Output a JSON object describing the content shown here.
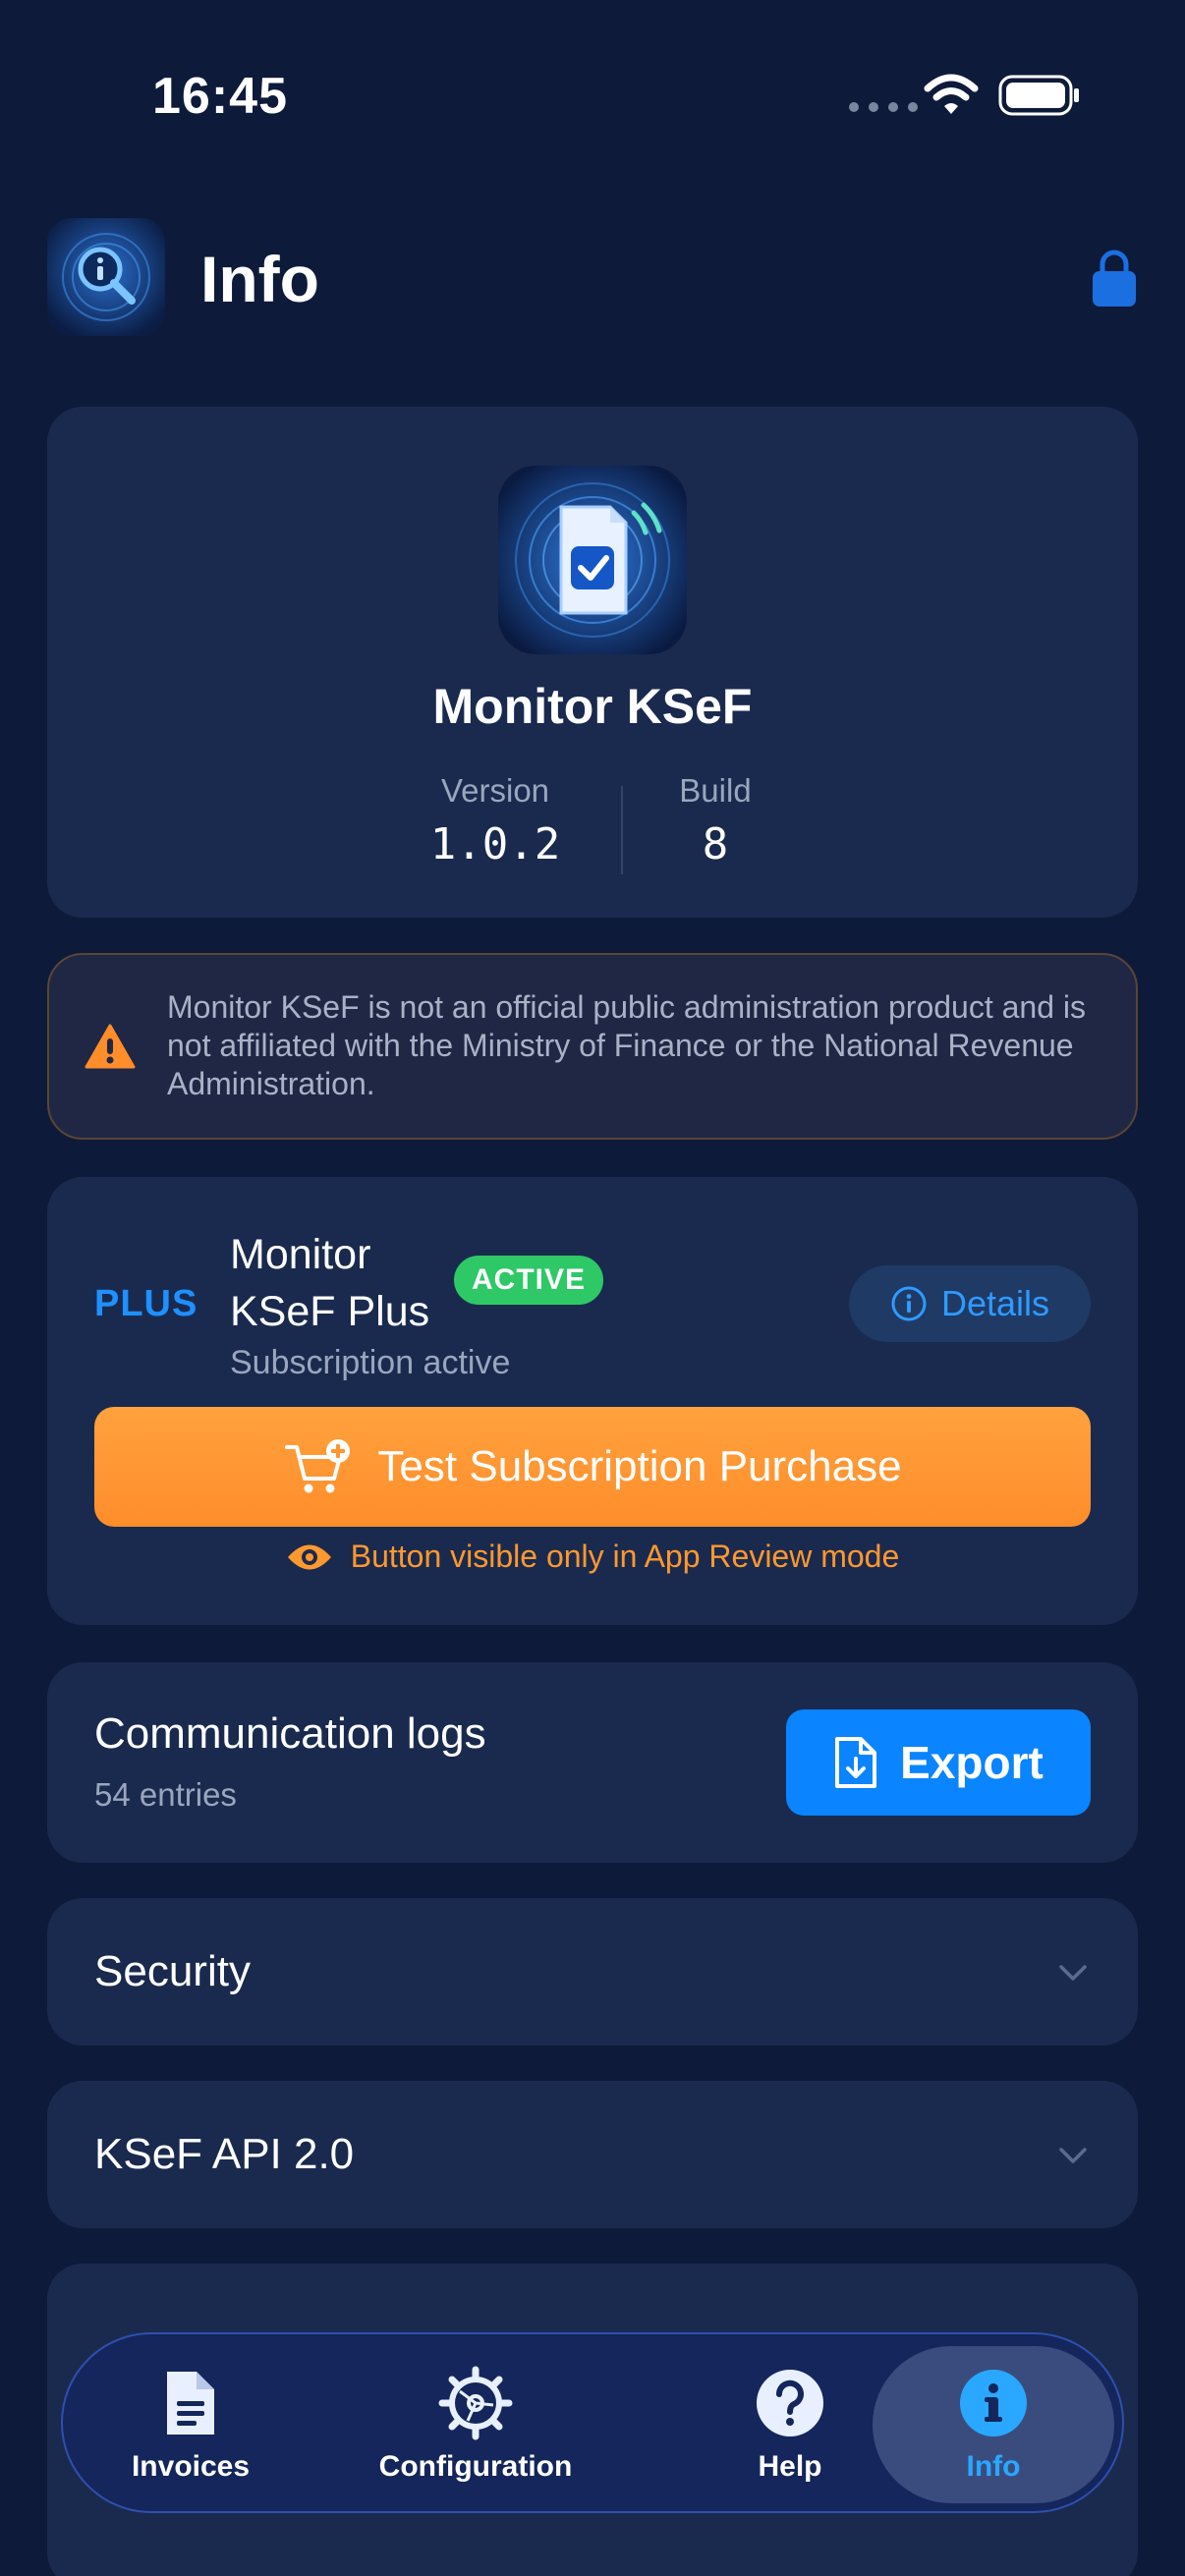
{
  "status_bar": {
    "time": "16:45"
  },
  "header": {
    "title": "Info"
  },
  "app_info": {
    "name": "Monitor KSeF",
    "version_label": "Version",
    "version": "1.0.2",
    "build_label": "Build",
    "build": "8"
  },
  "disclaimer": {
    "text": "Monitor KSeF is not an official public administration product and is not affiliated with the Ministry of Finance or the National Revenue Administration."
  },
  "subscription": {
    "plus_label": "PLUS",
    "title": "Monitor KSeF Plus",
    "badge": "ACTIVE",
    "status": "Subscription active",
    "details_label": "Details",
    "purchase_label": "Test Subscription Purchase",
    "review_note": "Button visible only in App Review mode"
  },
  "logs": {
    "title": "Communication logs",
    "count": "54 entries",
    "export_label": "Export"
  },
  "sections": {
    "security": "Security",
    "api": "KSeF API 2.0"
  },
  "tabs": {
    "invoices": "Invoices",
    "configuration": "Configuration",
    "help": "Help",
    "info": "Info"
  },
  "colors": {
    "background": "#0e1a3a",
    "card": "#1a2a4e",
    "accent_blue": "#0a84ff",
    "accent_orange": "#ff8d2a",
    "badge_green": "#2ec866"
  }
}
